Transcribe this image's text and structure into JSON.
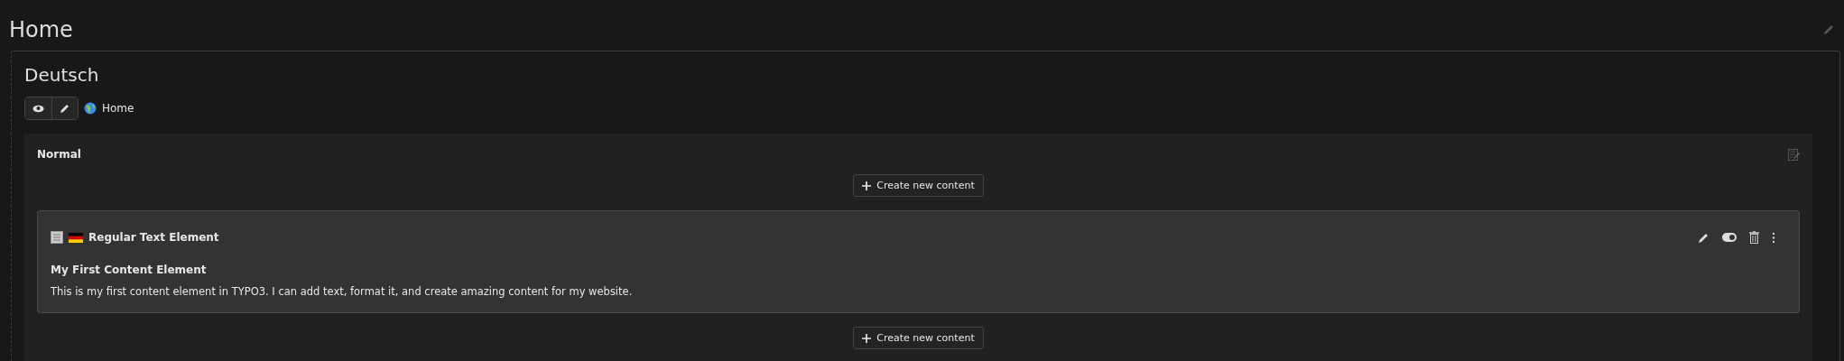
{
  "page": {
    "title": "Home"
  },
  "language": {
    "title": "Deutsch",
    "page_link": "Home"
  },
  "column": {
    "title": "Normal",
    "create_buttons": [
      "Create new content",
      "Create new content"
    ]
  },
  "content_element": {
    "type_label": "Regular Text Element",
    "header": "My First Content Element",
    "body": "This is my first content element in TYPO3. I can add text, format it, and create amazing content for my website.",
    "visible": true
  }
}
